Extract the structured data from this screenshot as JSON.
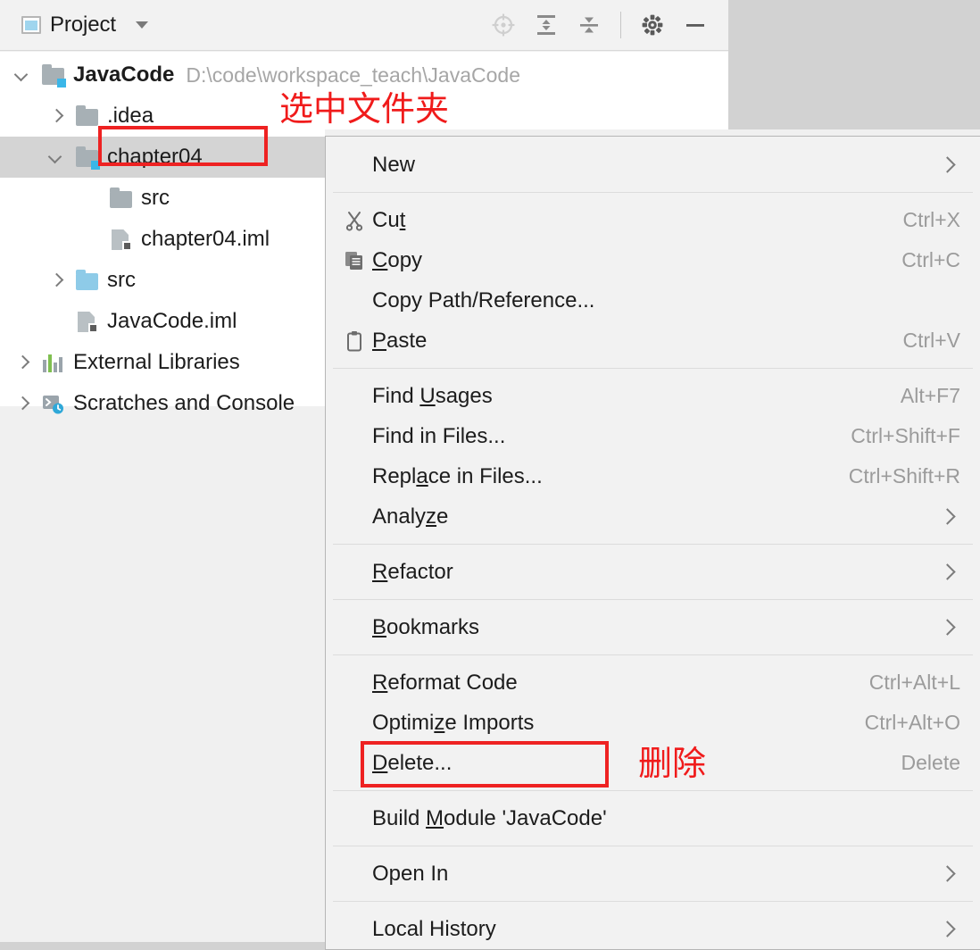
{
  "window": {
    "panel_title": "Project",
    "panel_icon": "project-window-icon",
    "dropdown_icon": "chevron-down-icon",
    "toolbar": [
      {
        "name": "select-opened-file-icon",
        "label": "Select Opened File"
      },
      {
        "name": "expand-all-icon",
        "label": "Expand All"
      },
      {
        "name": "collapse-all-icon",
        "label": "Collapse All"
      },
      {
        "name": "settings-gear-icon",
        "label": "Settings"
      },
      {
        "name": "hide-minimize-icon",
        "label": "Hide"
      }
    ]
  },
  "tree": {
    "rows": [
      {
        "label": "JavaCode",
        "secondary": "D:\\code\\workspace_teach\\JavaCode",
        "icon": "module-folder-icon",
        "toggle": "expanded",
        "indent": 0,
        "bold": true,
        "selected": false
      },
      {
        "label": ".idea",
        "secondary": "",
        "icon": "folder-icon",
        "toggle": "collapsed",
        "indent": 1,
        "bold": false,
        "selected": false
      },
      {
        "label": "chapter04",
        "secondary": "",
        "icon": "module-folder-icon",
        "toggle": "expanded",
        "indent": 1,
        "bold": false,
        "selected": true
      },
      {
        "label": "src",
        "secondary": "",
        "icon": "folder-icon",
        "toggle": "none",
        "indent": 2,
        "bold": false,
        "selected": false
      },
      {
        "label": "chapter04.iml",
        "secondary": "",
        "icon": "iml-file-icon",
        "toggle": "none",
        "indent": 2,
        "bold": false,
        "selected": false
      },
      {
        "label": "src",
        "secondary": "",
        "icon": "source-folder-icon",
        "toggle": "collapsed",
        "indent": 1,
        "bold": false,
        "selected": false
      },
      {
        "label": "JavaCode.iml",
        "secondary": "",
        "icon": "iml-file-icon",
        "toggle": "none",
        "indent": 1,
        "bold": false,
        "selected": false
      },
      {
        "label": "External Libraries",
        "secondary": "",
        "icon": "libraries-icon",
        "toggle": "collapsed",
        "indent": 0,
        "bold": false,
        "selected": false
      },
      {
        "label": "Scratches and Console",
        "secondary": "",
        "icon": "scratches-icon",
        "toggle": "collapsed",
        "indent": 0,
        "bold": false,
        "selected": false
      }
    ]
  },
  "context_menu": {
    "items": [
      {
        "label": "New",
        "mnemonic": "",
        "accel": "",
        "submenu": true,
        "icon": "",
        "separator_after": true
      },
      {
        "label": "Cut",
        "mnemonic": "t",
        "accel": "Ctrl+X",
        "submenu": false,
        "icon": "cut-scissors-icon",
        "separator_after": false
      },
      {
        "label": "Copy",
        "mnemonic": "C",
        "accel": "Ctrl+C",
        "submenu": false,
        "icon": "copy-icon",
        "separator_after": false
      },
      {
        "label": "Copy Path/Reference...",
        "mnemonic": "",
        "accel": "",
        "submenu": false,
        "icon": "",
        "separator_after": false
      },
      {
        "label": "Paste",
        "mnemonic": "P",
        "accel": "Ctrl+V",
        "submenu": false,
        "icon": "paste-clipboard-icon",
        "separator_after": true
      },
      {
        "label": "Find Usages",
        "mnemonic": "U",
        "accel": "Alt+F7",
        "submenu": false,
        "icon": "",
        "separator_after": false
      },
      {
        "label": "Find in Files...",
        "mnemonic": "",
        "accel": "Ctrl+Shift+F",
        "submenu": false,
        "icon": "",
        "separator_after": false
      },
      {
        "label": "Replace in Files...",
        "mnemonic": "a",
        "accel": "Ctrl+Shift+R",
        "submenu": false,
        "icon": "",
        "separator_after": false
      },
      {
        "label": "Analyze",
        "mnemonic": "z",
        "accel": "",
        "submenu": true,
        "icon": "",
        "separator_after": true
      },
      {
        "label": "Refactor",
        "mnemonic": "R",
        "accel": "",
        "submenu": true,
        "icon": "",
        "separator_after": true
      },
      {
        "label": "Bookmarks",
        "mnemonic": "B",
        "accel": "",
        "submenu": true,
        "icon": "",
        "separator_after": true
      },
      {
        "label": "Reformat Code",
        "mnemonic": "R",
        "accel": "Ctrl+Alt+L",
        "submenu": false,
        "icon": "",
        "separator_after": false
      },
      {
        "label": "Optimize Imports",
        "mnemonic": "z",
        "accel": "Ctrl+Alt+O",
        "submenu": false,
        "icon": "",
        "separator_after": false
      },
      {
        "label": "Delete...",
        "mnemonic": "D",
        "accel": "Delete",
        "submenu": false,
        "icon": "",
        "separator_after": true
      },
      {
        "label": "Build Module 'JavaCode'",
        "mnemonic": "M",
        "accel": "",
        "submenu": false,
        "icon": "",
        "separator_after": true
      },
      {
        "label": "Open In",
        "mnemonic": "",
        "accel": "",
        "submenu": true,
        "icon": "",
        "separator_after": true
      },
      {
        "label": "Local History",
        "mnemonic": "",
        "accel": "",
        "submenu": true,
        "icon": "",
        "separator_after": false
      }
    ]
  },
  "annotations": {
    "accent_color": "#ee2222",
    "select_folder_text": "选中文件夹",
    "delete_text": "删除"
  }
}
